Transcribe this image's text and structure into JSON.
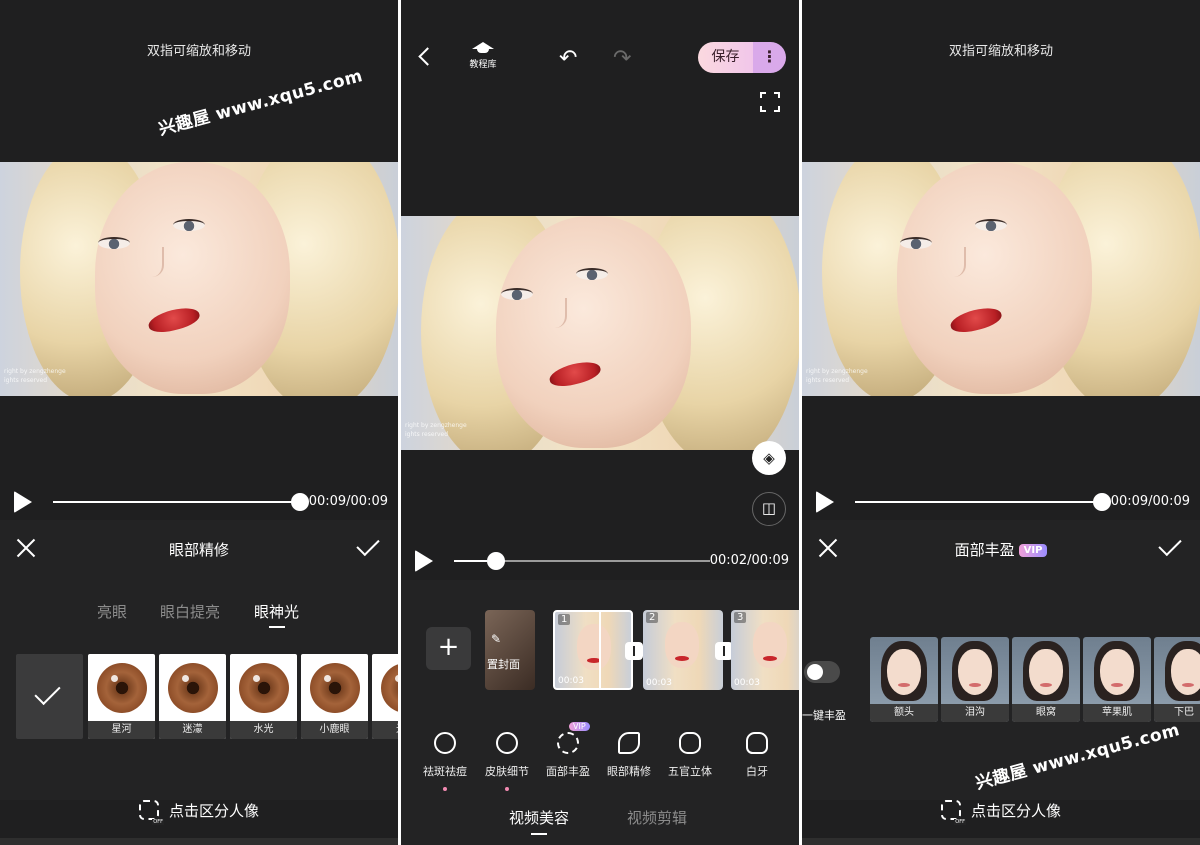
{
  "watermark": "兴趣屋 www.xqu5.com",
  "photo_credit": [
    "right by zengzhenge",
    "ights reserved"
  ],
  "panel1": {
    "hint": "双指可缩放和移动",
    "time": "00:09/00:09",
    "progress": 1.0,
    "title": "眼部精修",
    "subtabs": [
      "亮眼",
      "眼白提亮",
      "眼神光"
    ],
    "active_subtab": "眼神光",
    "options": [
      "星河",
      "迷濛",
      "水光",
      "小鹿眼",
      "光"
    ],
    "bottom_label": "点击区分人像"
  },
  "panel2": {
    "tutorial_label": "教程库",
    "save_label": "保存",
    "more_label": "⋮",
    "time": "00:02/00:09",
    "progress": 0.13,
    "cover_label": "置封面",
    "clips": [
      {
        "num": "1",
        "dur": "00:03"
      },
      {
        "num": "2",
        "dur": "00:03"
      },
      {
        "num": "3",
        "dur": "00:03"
      }
    ],
    "tools": [
      "祛斑祛痘",
      "皮肤细节",
      "面部丰盈",
      "眼部精修",
      "五官立体",
      "白牙"
    ],
    "tool_vip_badge": "VIP",
    "tabs": [
      "视频美容",
      "视频剪辑"
    ],
    "active_tab": "视频美容"
  },
  "panel3": {
    "hint": "双指可缩放和移动",
    "time": "00:09/00:09",
    "progress": 1.0,
    "title": "面部丰盈",
    "vip_badge": "VIP",
    "toggle_label": "一键丰盈",
    "options": [
      "额头",
      "泪沟",
      "眼窝",
      "苹果肌",
      "下巴"
    ],
    "bottom_label": "点击区分人像"
  },
  "icons": {
    "back": "chevron-left-icon",
    "undo": "undo-icon",
    "redo": "redo-icon",
    "fullscreen": "fullscreen-icon",
    "layers": "layers-icon",
    "compare": "compare-icon"
  }
}
